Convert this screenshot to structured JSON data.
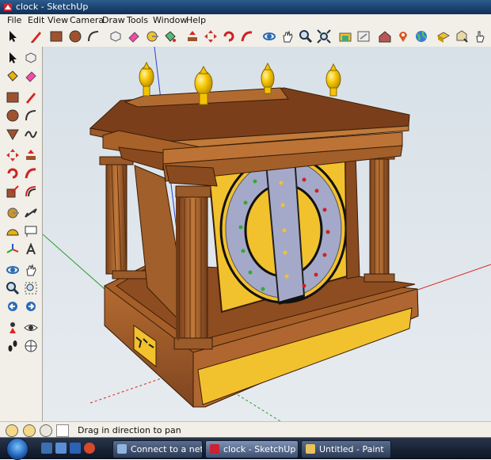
{
  "window": {
    "title": "clock - SketchUp"
  },
  "menu": {
    "items": [
      "File",
      "Edit",
      "View",
      "Camera",
      "Draw",
      "Tools",
      "Window",
      "Help"
    ]
  },
  "colors": {
    "title_bar": "#1d4472",
    "wood": "#9b5a2a",
    "clock_face": "#f2c12e",
    "dial_ring": "#a5a9c9",
    "finial": "#f5c400"
  },
  "statusbar": {
    "hint": "Drag in direction to pan"
  },
  "taskbar": {
    "items": [
      {
        "label": "Connect to a network",
        "active": false
      },
      {
        "label": "clock - SketchUp",
        "active": true
      },
      {
        "label": "Untitled - Paint",
        "active": false
      }
    ]
  }
}
